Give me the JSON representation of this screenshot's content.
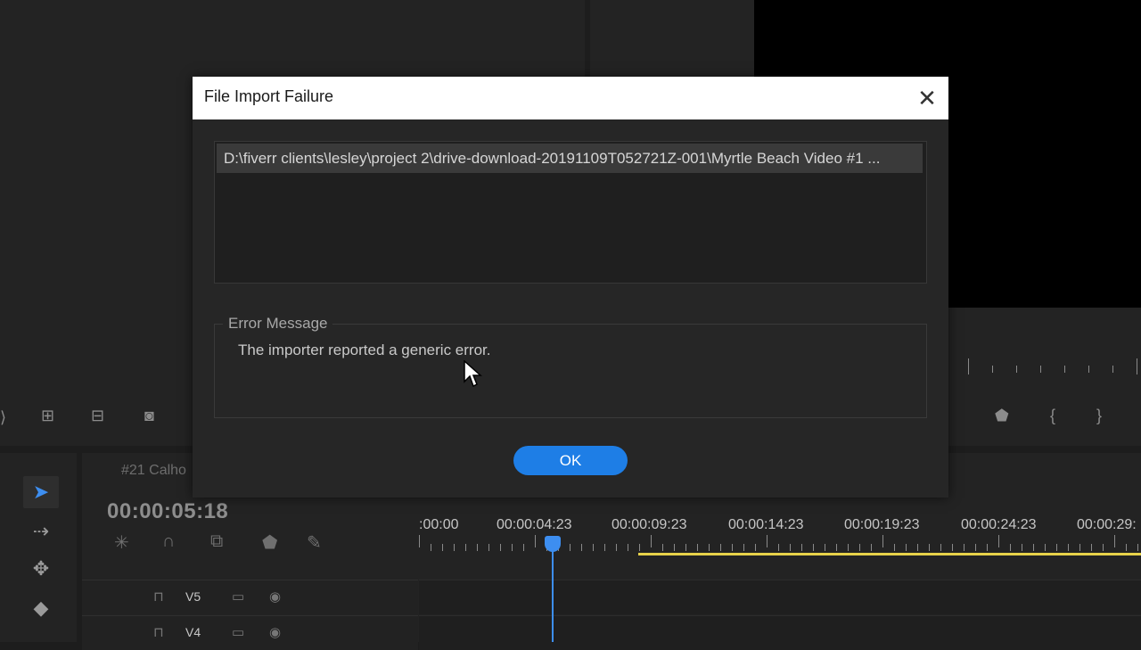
{
  "dialog": {
    "title": "File Import Failure",
    "close_icon": "close-icon",
    "files": [
      "D:\\fiverr clients\\lesley\\project 2\\drive-download-20191109T052721Z-001\\Myrtle Beach Video #1 ..."
    ],
    "error_group_label": "Error Message",
    "error_text": "The importer reported a generic error.",
    "ok_label": "OK",
    "accent_color": "#1e7ee6"
  },
  "timeline": {
    "sequence_tab": "#21 Calho",
    "timecode": "00:00:05:18",
    "ruler_labels": [
      ":00:00",
      "00:00:04:23",
      "00:00:09:23",
      "00:00:14:23",
      "00:00:19:23",
      "00:00:24:23",
      "00:00:29:"
    ],
    "tracks": [
      {
        "label": "V5"
      },
      {
        "label": "V4"
      }
    ],
    "playhead_color": "#3d8ef0",
    "work_area_color": "#e7d24a"
  }
}
